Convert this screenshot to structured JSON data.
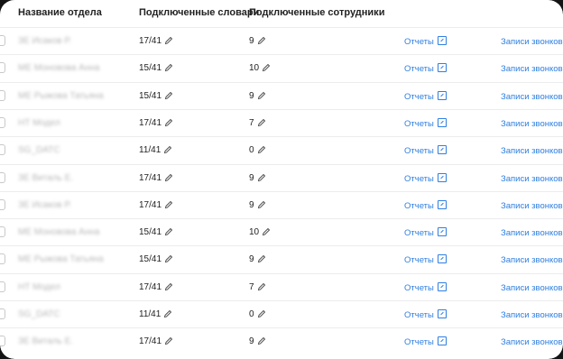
{
  "header": {
    "name": "Название отдела",
    "dictionaries": "Подключенные словари",
    "employees": "Подключенные сотрудники"
  },
  "rows": [
    {
      "name": "ЗЕ Исаков Р.",
      "dictionaries": "17/41",
      "employees": "9",
      "reports": "Отчеты",
      "calls": "Записи звонков"
    },
    {
      "name": "МЕ Моновова Анна",
      "dictionaries": "15/41",
      "employees": "10",
      "reports": "Отчеты",
      "calls": "Записи звонков"
    },
    {
      "name": "МЕ Рыжова Татьяна",
      "dictionaries": "15/41",
      "employees": "9",
      "reports": "Отчеты",
      "calls": "Записи звонков"
    },
    {
      "name": "НТ Модел",
      "dictionaries": "17/41",
      "employees": "7",
      "reports": "Отчеты",
      "calls": "Записи звонков"
    },
    {
      "name": "SG_DATC",
      "dictionaries": "11/41",
      "employees": "0",
      "reports": "Отчеты",
      "calls": "Записи звонков"
    },
    {
      "name": "ЗЕ Виталь Е.",
      "dictionaries": "17/41",
      "employees": "9",
      "reports": "Отчеты",
      "calls": "Записи звонков"
    },
    {
      "name": "ЗЕ Исаков Р.",
      "dictionaries": "17/41",
      "employees": "9",
      "reports": "Отчеты",
      "calls": "Записи звонков"
    },
    {
      "name": "МЕ Моновова Анна",
      "dictionaries": "15/41",
      "employees": "10",
      "reports": "Отчеты",
      "calls": "Записи звонков"
    },
    {
      "name": "МЕ Рыжова Татьяна",
      "dictionaries": "15/41",
      "employees": "9",
      "reports": "Отчеты",
      "calls": "Записи звонков"
    },
    {
      "name": "НТ Модел",
      "dictionaries": "17/41",
      "employees": "7",
      "reports": "Отчеты",
      "calls": "Записи звонков"
    },
    {
      "name": "SG_DATC",
      "dictionaries": "11/41",
      "employees": "0",
      "reports": "Отчеты",
      "calls": "Записи звонков"
    },
    {
      "name": "ЗЕ Виталь Е.",
      "dictionaries": "17/41",
      "employees": "9",
      "reports": "Отчеты",
      "calls": "Записи звонков"
    }
  ]
}
